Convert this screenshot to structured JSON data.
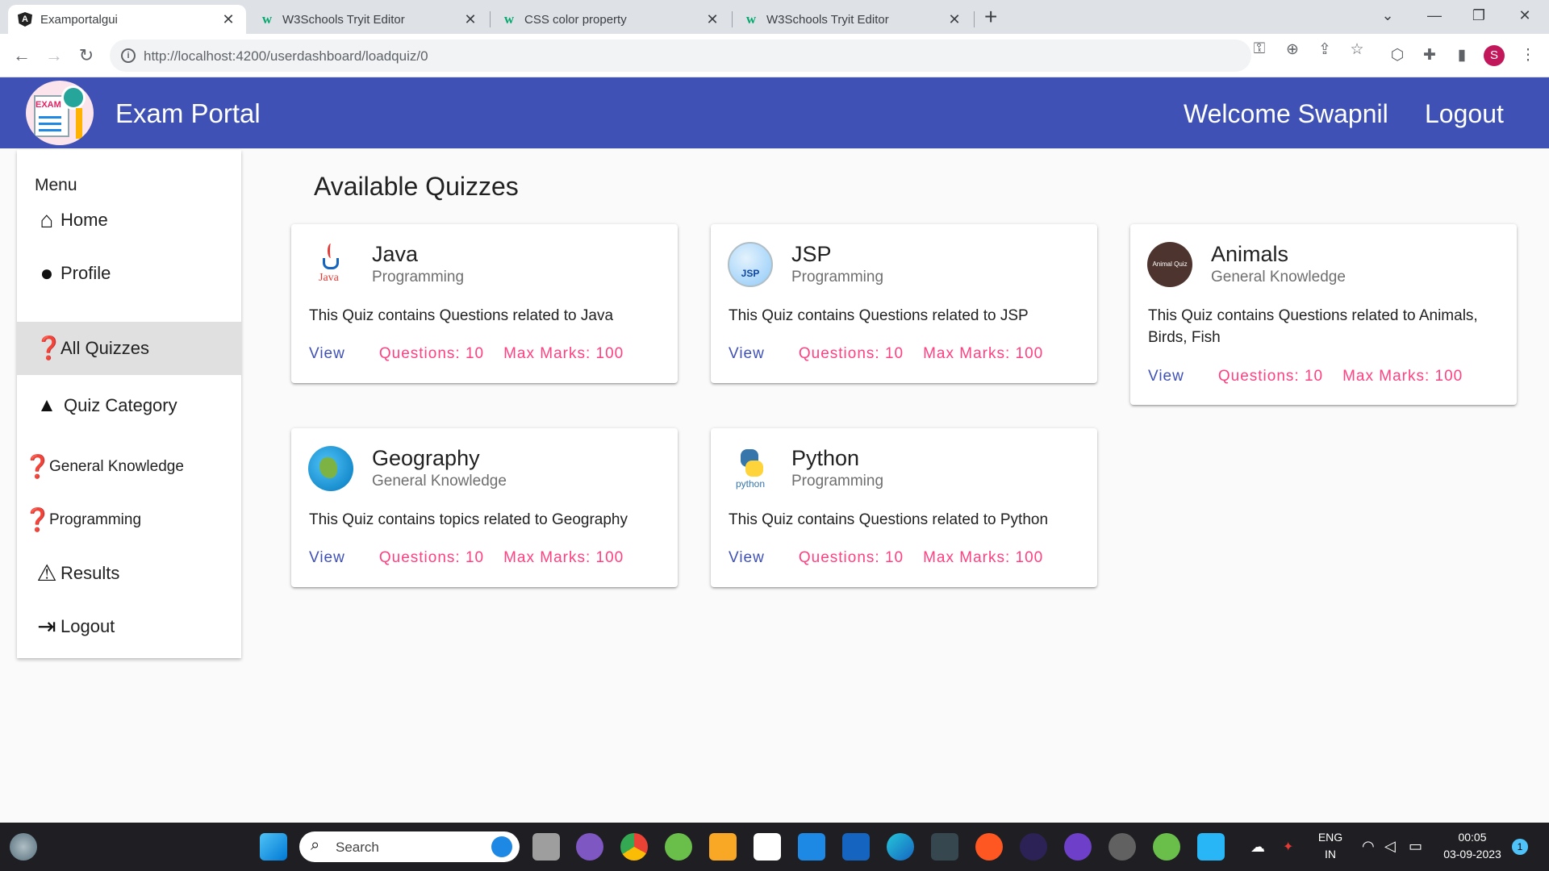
{
  "browser": {
    "tabs": [
      {
        "title": "Examportalgui",
        "favicon": "angular-icon"
      },
      {
        "title": "W3Schools Tryit Editor",
        "favicon": "w3schools-icon"
      },
      {
        "title": "CSS color property",
        "favicon": "w3schools-icon"
      },
      {
        "title": "W3Schools Tryit Editor",
        "favicon": "w3schools-icon"
      }
    ],
    "url": "http://localhost:4200/userdashboard/loadquiz/0",
    "profile_initial": "S"
  },
  "header": {
    "brand": "Exam Portal",
    "welcome": "Welcome Swapnil",
    "logout": "Logout",
    "color": "#3f51b5"
  },
  "sidebar": {
    "title": "Menu",
    "items": [
      {
        "label": "Home",
        "icon": "home-icon"
      },
      {
        "label": "Profile",
        "icon": "account-circle-icon"
      },
      {
        "label": "All Quizzes",
        "icon": "quiz-icon",
        "active": true
      },
      {
        "label": "Quiz Category",
        "icon": "category-icon"
      },
      {
        "label": "General Knowledge",
        "icon": "quiz-icon"
      },
      {
        "label": "Programming",
        "icon": "quiz-icon"
      },
      {
        "label": "Results",
        "icon": "error-icon"
      },
      {
        "label": "Logout",
        "icon": "logout-icon"
      }
    ]
  },
  "main": {
    "title": "Available Quizzes",
    "quizzes": [
      {
        "title": "Java",
        "category": "Programming",
        "description": "This Quiz contains Questions related to Java",
        "view": "View",
        "questions": "Questions: 10",
        "max_marks": "Max Marks: 100",
        "avatar_text": "Java"
      },
      {
        "title": "JSP",
        "category": "Programming",
        "description": "This Quiz contains Questions related to JSP",
        "view": "View",
        "questions": "Questions: 10",
        "max_marks": "Max Marks: 100",
        "avatar_text": "JSP"
      },
      {
        "title": "Animals",
        "category": "General Knowledge",
        "description": "This Quiz contains Questions related to Animals, Birds, Fish",
        "view": "View",
        "questions": "Questions: 10",
        "max_marks": "Max Marks: 100",
        "avatar_text": "Animal Quiz"
      },
      {
        "title": "Geography",
        "category": "General Knowledge",
        "description": "This Quiz contains topics related to Geography",
        "view": "View",
        "questions": "Questions: 10",
        "max_marks": "Max Marks: 100"
      },
      {
        "title": "Python",
        "category": "Programming",
        "description": "This Quiz contains Questions related to Python",
        "view": "View",
        "questions": "Questions: 10",
        "max_marks": "Max Marks: 100",
        "avatar_text": "python"
      }
    ],
    "accent_primary": "#3f51b5",
    "accent_secondary": "#ff4081"
  },
  "taskbar": {
    "search_placeholder": "Search",
    "language": "ENG",
    "region": "IN",
    "time": "00:05",
    "date": "03-09-2023",
    "notification_count": "1"
  }
}
